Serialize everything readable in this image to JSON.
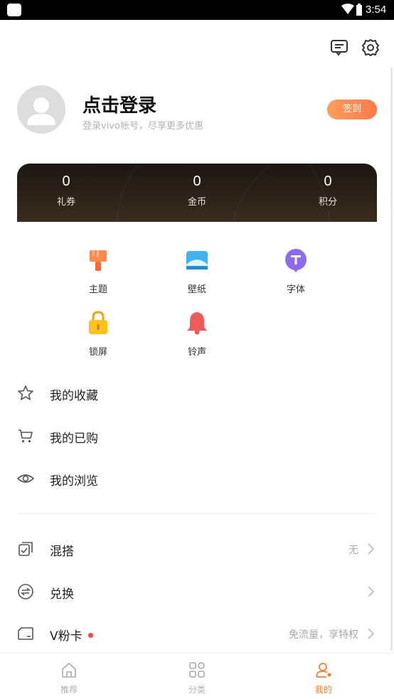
{
  "status_bar": {
    "time": "3:54"
  },
  "profile": {
    "title": "点击登录",
    "subtitle": "登录vivo帐号，尽享更多优惠",
    "signin_label": "签到"
  },
  "stats": [
    {
      "value": "0",
      "label": "礼券"
    },
    {
      "value": "0",
      "label": "金币"
    },
    {
      "value": "0",
      "label": "积分"
    }
  ],
  "features": [
    {
      "label": "主题",
      "icon": "paint-brush-icon"
    },
    {
      "label": "壁纸",
      "icon": "wallpaper-icon"
    },
    {
      "label": "字体",
      "icon": "font-icon"
    },
    {
      "label": "锁屏",
      "icon": "lock-icon"
    },
    {
      "label": "铃声",
      "icon": "bell-icon"
    }
  ],
  "menu": [
    {
      "label": "我的收藏",
      "icon": "star-icon"
    },
    {
      "label": "我的已购",
      "icon": "cart-icon"
    },
    {
      "label": "我的浏览",
      "icon": "eye-icon"
    }
  ],
  "settings": [
    {
      "label": "混搭",
      "value": "无",
      "icon": "mix-icon"
    },
    {
      "label": "兑换",
      "value": "",
      "icon": "exchange-icon"
    },
    {
      "label": "V粉卡",
      "value": "免流量，享特权",
      "icon": "card-icon"
    }
  ],
  "nav": [
    {
      "label": "推荐",
      "icon": "home-icon"
    },
    {
      "label": "分类",
      "icon": "category-icon"
    },
    {
      "label": "我的",
      "icon": "profile-icon",
      "active": true
    }
  ],
  "colors": {
    "accent": "#ff7e2e",
    "card_dark": "#1c1712",
    "red_dot": "#f04646"
  }
}
